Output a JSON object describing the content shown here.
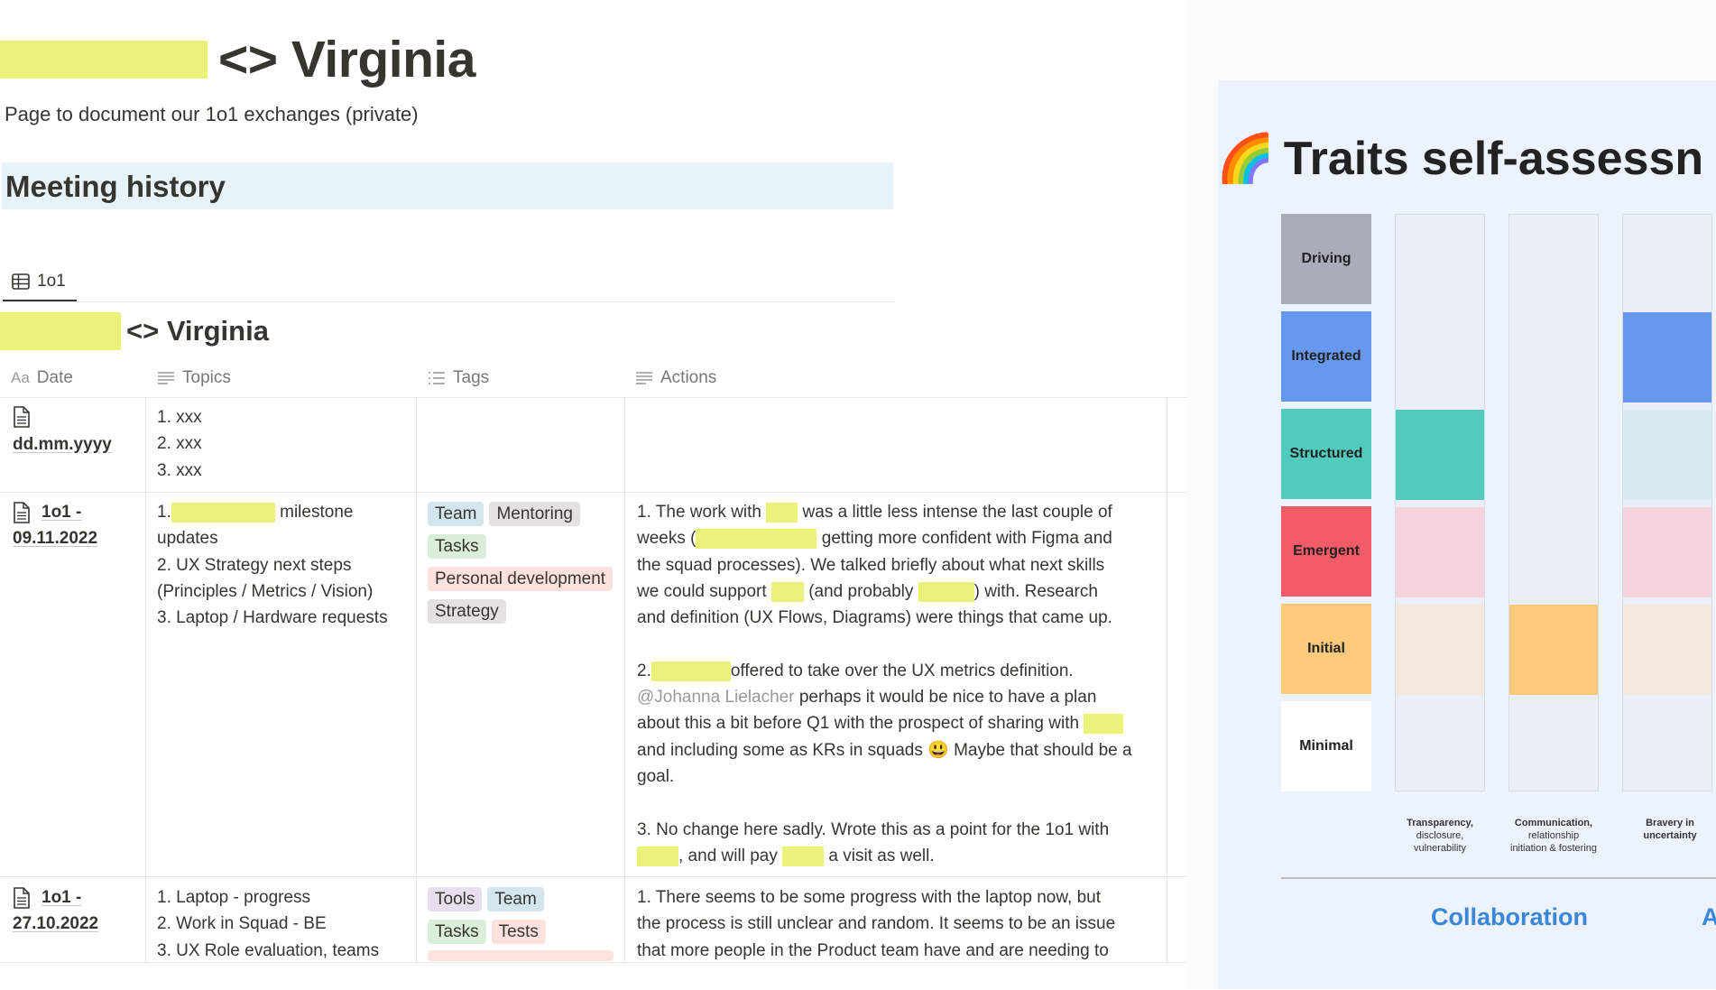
{
  "page": {
    "title": "<> Virginia",
    "subtitle": "Page to document our 1o1 exchanges (private)",
    "callout": "Meeting history",
    "view_tab": "1o1",
    "database_title": "<> Virginia"
  },
  "table": {
    "columns": [
      {
        "icon": "Aa",
        "label": "Date"
      },
      {
        "icon": "text-lines-icon",
        "label": "Topics"
      },
      {
        "icon": "list-icon",
        "label": "Tags"
      },
      {
        "icon": "text-lines-icon",
        "label": "Actions"
      }
    ],
    "rows": [
      {
        "date": "dd.mm.yyyy",
        "topics": [
          "1. xxx",
          "2. xxx",
          "3. xxx"
        ],
        "tags": [],
        "actions": []
      },
      {
        "date_line1": "1o1 -",
        "date_line2": "09.11.2022",
        "topics": {
          "t1_prefix": "1.",
          "t1_suffix": " milestone",
          "t1_cont": "updates",
          "t2a": "2. UX Strategy next steps",
          "t2b": "(Principles / Metrics / Vision)",
          "t3": "3. Laptop / Hardware requests"
        },
        "tags": [
          "Team",
          "Mentoring",
          "Tasks",
          "Personal development",
          "Strategy"
        ],
        "actions": {
          "a1_l1a": "1. The work with ",
          "a1_l1b": " was a little less intense the last couple of",
          "a1_l2a": "weeks (",
          "a1_l2b": " getting more confident with Figma and",
          "a1_l3": "the squad processes). We talked briefly about what next skills",
          "a1_l4a": "we could support ",
          "a1_l4b": " (and probably ",
          "a1_l4c": ") with. Research",
          "a1_l5": "and definition (UX Flows, Diagrams) were things that came up.",
          "a2_l1a": "2.",
          "a2_l1b": "offered to take over the UX metrics definition.",
          "a2_mention": "@Johanna Lielacher",
          "a2_l2b": " perhaps it would be nice to have a plan",
          "a2_l3": "about this a bit before Q1 with the prospect of sharing with ",
          "a2_l4": "and including some as KRs in squads 😃 Maybe that should be a",
          "a2_l5": "goal.",
          "a3_l1": "3. No change here sadly. Wrote this as a point for the 1o1 with",
          "a3_l2a": ", and will pay ",
          "a3_l2b": " a visit as well."
        }
      },
      {
        "date_line1": "1o1 -",
        "date_line2": "27.10.2022",
        "topics": [
          "1. Laptop - progress",
          "2. Work in Squad - BE",
          "3. UX Role evaluation, teams"
        ],
        "tags": [
          "Tools",
          "Team",
          "Tasks",
          "Tests"
        ],
        "actions": [
          "1. There seems to be some progress with the laptop now, but",
          "the process is still unclear and random. It seems to be an issue",
          "that more people in the Product team have and are needing to"
        ]
      }
    ]
  },
  "figure": {
    "title": "Traits self-assessn",
    "title_emoji": "🌈",
    "levels": [
      "Driving",
      "Integrated",
      "Structured",
      "Emergent",
      "Initial",
      "Minimal"
    ],
    "columns": [
      {
        "label_bold": "Transparency,",
        "label_rest": [
          "disclosure,",
          "vulnerability"
        ],
        "selected_level": "Structured"
      },
      {
        "label_bold": "Communication,",
        "label_rest": [
          "relationship",
          "initiation & fostering"
        ],
        "selected_level": "Initial"
      },
      {
        "label_bold": "Bravery in",
        "label_rest": [
          "uncertainty"
        ],
        "selected_level": "Integrated"
      }
    ],
    "categories": [
      "Collaboration",
      "A"
    ],
    "colors": {
      "driving": "#a9adb9",
      "integrated": "#6698f0",
      "structured": "#52cbbf",
      "emergent": "#f45b68",
      "initial": "#fdc97b",
      "minimal": "#ffffff",
      "structured_light": "#d6ecf0",
      "emergent_light": "#f7d3dd",
      "initial_light": "#f5e7dc",
      "accent_blue": "#3a86d8",
      "redaction": "#eaf27a"
    }
  }
}
